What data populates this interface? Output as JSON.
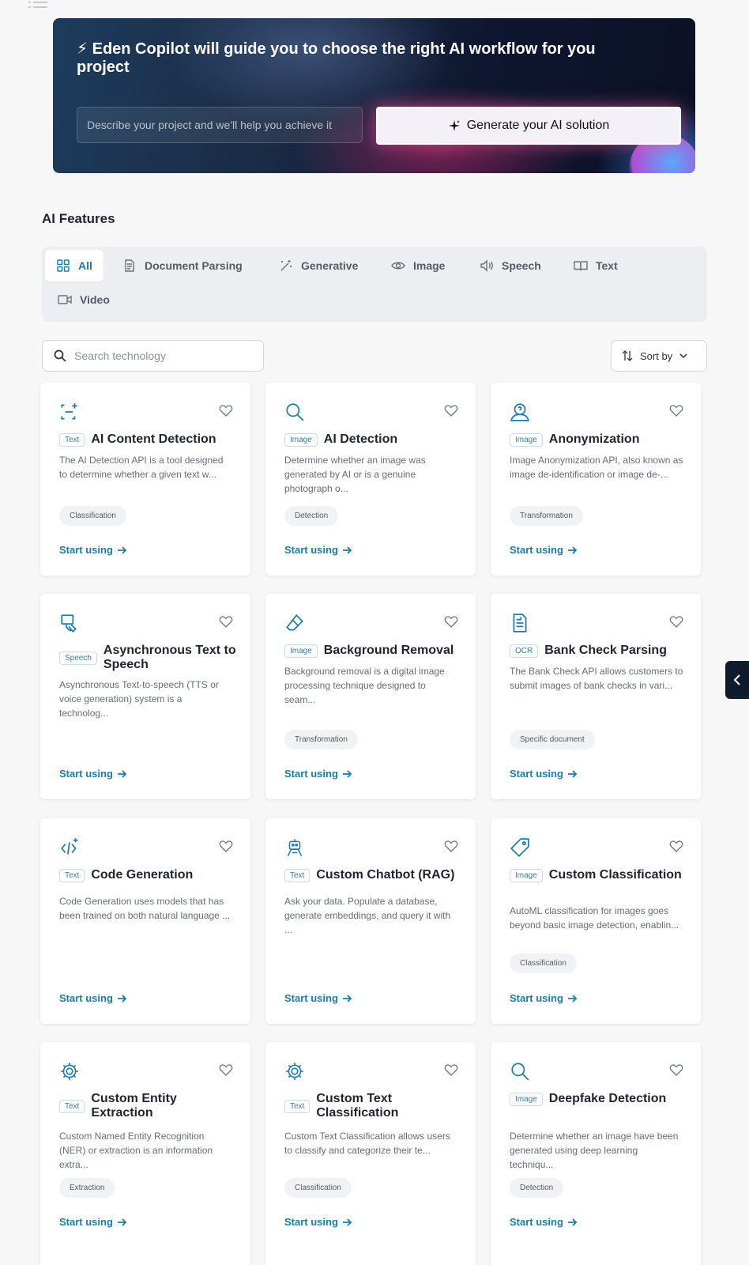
{
  "banner": {
    "title": "⚡ Eden Copilot will guide you to choose the right AI workflow for you project",
    "input_placeholder": "Describe your project and we'll help you achieve it",
    "button_label": "Generate your AI solution"
  },
  "section_title": "AI Features",
  "tabs": [
    {
      "label": "All",
      "icon": "grid-icon",
      "active": true
    },
    {
      "label": "Document Parsing",
      "icon": "document-icon"
    },
    {
      "label": "Generative",
      "icon": "magic-wand-icon"
    },
    {
      "label": "Image",
      "icon": "eye-icon"
    },
    {
      "label": "Speech",
      "icon": "speaker-icon"
    },
    {
      "label": "Text",
      "icon": "book-icon"
    },
    {
      "label": "Video",
      "icon": "video-icon"
    }
  ],
  "search": {
    "placeholder": "Search technology"
  },
  "sort": {
    "label": "Sort by"
  },
  "start_label": "Start using",
  "cards": [
    {
      "badge": "Text",
      "title": "AI Content Detection",
      "desc": "The AI Detection API is a tool designed to determine whether a given text w...",
      "tag": "Classification",
      "icon": "ai-scan-icon"
    },
    {
      "badge": "Image",
      "title": "AI Detection",
      "desc": "Determine whether an image was generated by AI or is a genuine photograph o...",
      "tag": "Detection",
      "icon": "magnifier-icon"
    },
    {
      "badge": "Image",
      "title": "Anonymization",
      "desc": "Image Anonymization API, also known as image de-identification or image de-...",
      "tag": "Transformation",
      "icon": "anonymous-user-icon"
    },
    {
      "badge": "Speech",
      "title": "Asynchronous Text to Speech",
      "desc": "Asynchronous Text-to-speech (TTS or voice generation) system is a technolog...",
      "tag": "",
      "icon": "speech-icon"
    },
    {
      "badge": "Image",
      "title": "Background Removal",
      "desc": "Background removal is a digital image processing technique designed to seam...",
      "tag": "Transformation",
      "icon": "eraser-icon"
    },
    {
      "badge": "OCR",
      "title": "Bank Check Parsing",
      "desc": "The Bank Check API allows customers to submit images of bank checks in vari...",
      "tag": "Specific document",
      "icon": "check-document-icon"
    },
    {
      "badge": "Text",
      "title": "Code Generation",
      "desc": "Code Generation uses models that has been trained on both natural language ...",
      "tag": "",
      "icon": "code-icon"
    },
    {
      "badge": "Text",
      "title": "Custom Chatbot (RAG)",
      "desc": "Ask your data. Populate a database, generate embeddings, and query it with ...",
      "tag": "",
      "icon": "robot-icon"
    },
    {
      "badge": "Image",
      "title": "Custom Classification",
      "desc": "AutoML classification for images goes beyond basic image detection, enablin...",
      "tag": "Classification",
      "icon": "price-tag-icon"
    },
    {
      "badge": "Text",
      "title": "Custom Entity Extraction",
      "desc": "Custom Named Entity Recognition (NER) or extraction is an information extra...",
      "tag": "Extraction",
      "icon": "gear-icon"
    },
    {
      "badge": "Text",
      "title": "Custom Text Classification",
      "desc": "Custom Text Classification allows users to classify and categorize their te...",
      "tag": "Classification",
      "icon": "gear-icon"
    },
    {
      "badge": "Image",
      "title": "Deepfake Detection",
      "desc": "Determine whether an image have been generated using deep learning techniqu...",
      "tag": "Detection",
      "icon": "magnifier-icon"
    }
  ]
}
